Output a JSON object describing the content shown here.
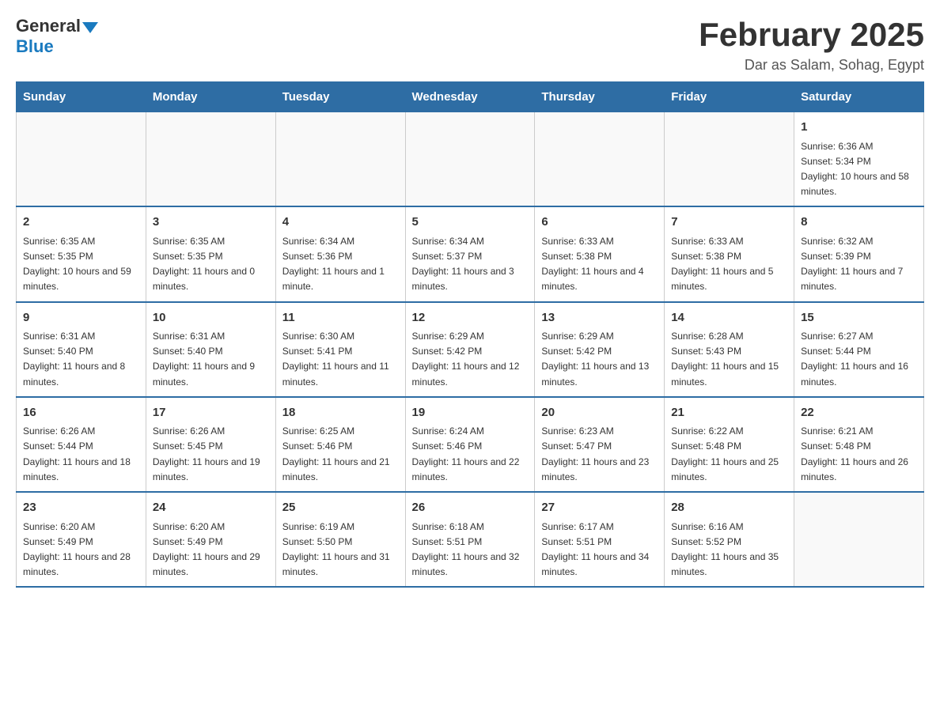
{
  "header": {
    "logo_general": "General",
    "logo_blue": "Blue",
    "month_title": "February 2025",
    "location": "Dar as Salam, Sohag, Egypt"
  },
  "days_of_week": [
    "Sunday",
    "Monday",
    "Tuesday",
    "Wednesday",
    "Thursday",
    "Friday",
    "Saturday"
  ],
  "weeks": [
    [
      {
        "day": "",
        "info": ""
      },
      {
        "day": "",
        "info": ""
      },
      {
        "day": "",
        "info": ""
      },
      {
        "day": "",
        "info": ""
      },
      {
        "day": "",
        "info": ""
      },
      {
        "day": "",
        "info": ""
      },
      {
        "day": "1",
        "info": "Sunrise: 6:36 AM\nSunset: 5:34 PM\nDaylight: 10 hours and 58 minutes."
      }
    ],
    [
      {
        "day": "2",
        "info": "Sunrise: 6:35 AM\nSunset: 5:35 PM\nDaylight: 10 hours and 59 minutes."
      },
      {
        "day": "3",
        "info": "Sunrise: 6:35 AM\nSunset: 5:35 PM\nDaylight: 11 hours and 0 minutes."
      },
      {
        "day": "4",
        "info": "Sunrise: 6:34 AM\nSunset: 5:36 PM\nDaylight: 11 hours and 1 minute."
      },
      {
        "day": "5",
        "info": "Sunrise: 6:34 AM\nSunset: 5:37 PM\nDaylight: 11 hours and 3 minutes."
      },
      {
        "day": "6",
        "info": "Sunrise: 6:33 AM\nSunset: 5:38 PM\nDaylight: 11 hours and 4 minutes."
      },
      {
        "day": "7",
        "info": "Sunrise: 6:33 AM\nSunset: 5:38 PM\nDaylight: 11 hours and 5 minutes."
      },
      {
        "day": "8",
        "info": "Sunrise: 6:32 AM\nSunset: 5:39 PM\nDaylight: 11 hours and 7 minutes."
      }
    ],
    [
      {
        "day": "9",
        "info": "Sunrise: 6:31 AM\nSunset: 5:40 PM\nDaylight: 11 hours and 8 minutes."
      },
      {
        "day": "10",
        "info": "Sunrise: 6:31 AM\nSunset: 5:40 PM\nDaylight: 11 hours and 9 minutes."
      },
      {
        "day": "11",
        "info": "Sunrise: 6:30 AM\nSunset: 5:41 PM\nDaylight: 11 hours and 11 minutes."
      },
      {
        "day": "12",
        "info": "Sunrise: 6:29 AM\nSunset: 5:42 PM\nDaylight: 11 hours and 12 minutes."
      },
      {
        "day": "13",
        "info": "Sunrise: 6:29 AM\nSunset: 5:42 PM\nDaylight: 11 hours and 13 minutes."
      },
      {
        "day": "14",
        "info": "Sunrise: 6:28 AM\nSunset: 5:43 PM\nDaylight: 11 hours and 15 minutes."
      },
      {
        "day": "15",
        "info": "Sunrise: 6:27 AM\nSunset: 5:44 PM\nDaylight: 11 hours and 16 minutes."
      }
    ],
    [
      {
        "day": "16",
        "info": "Sunrise: 6:26 AM\nSunset: 5:44 PM\nDaylight: 11 hours and 18 minutes."
      },
      {
        "day": "17",
        "info": "Sunrise: 6:26 AM\nSunset: 5:45 PM\nDaylight: 11 hours and 19 minutes."
      },
      {
        "day": "18",
        "info": "Sunrise: 6:25 AM\nSunset: 5:46 PM\nDaylight: 11 hours and 21 minutes."
      },
      {
        "day": "19",
        "info": "Sunrise: 6:24 AM\nSunset: 5:46 PM\nDaylight: 11 hours and 22 minutes."
      },
      {
        "day": "20",
        "info": "Sunrise: 6:23 AM\nSunset: 5:47 PM\nDaylight: 11 hours and 23 minutes."
      },
      {
        "day": "21",
        "info": "Sunrise: 6:22 AM\nSunset: 5:48 PM\nDaylight: 11 hours and 25 minutes."
      },
      {
        "day": "22",
        "info": "Sunrise: 6:21 AM\nSunset: 5:48 PM\nDaylight: 11 hours and 26 minutes."
      }
    ],
    [
      {
        "day": "23",
        "info": "Sunrise: 6:20 AM\nSunset: 5:49 PM\nDaylight: 11 hours and 28 minutes."
      },
      {
        "day": "24",
        "info": "Sunrise: 6:20 AM\nSunset: 5:49 PM\nDaylight: 11 hours and 29 minutes."
      },
      {
        "day": "25",
        "info": "Sunrise: 6:19 AM\nSunset: 5:50 PM\nDaylight: 11 hours and 31 minutes."
      },
      {
        "day": "26",
        "info": "Sunrise: 6:18 AM\nSunset: 5:51 PM\nDaylight: 11 hours and 32 minutes."
      },
      {
        "day": "27",
        "info": "Sunrise: 6:17 AM\nSunset: 5:51 PM\nDaylight: 11 hours and 34 minutes."
      },
      {
        "day": "28",
        "info": "Sunrise: 6:16 AM\nSunset: 5:52 PM\nDaylight: 11 hours and 35 minutes."
      },
      {
        "day": "",
        "info": ""
      }
    ]
  ]
}
